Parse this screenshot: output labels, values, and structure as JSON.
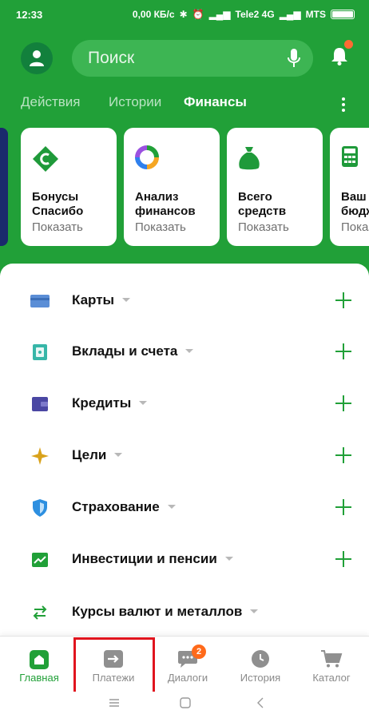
{
  "status_bar": {
    "time": "12:33",
    "speed": "0,00 КБ/с",
    "carrier1": "Tele2 4G",
    "carrier2": "MTS"
  },
  "header": {
    "search_placeholder": "Поиск"
  },
  "tabs": [
    {
      "label": "Действия",
      "active": false
    },
    {
      "label": "Истории",
      "active": false
    },
    {
      "label": "Финансы",
      "active": true
    }
  ],
  "cards": [
    {
      "line1": "Бонусы",
      "line2": "Спасибо",
      "action": "Показать",
      "icon": "spasibo-icon"
    },
    {
      "line1": "Анализ",
      "line2": "финансов",
      "action": "Показать",
      "icon": "pie-chart-icon"
    },
    {
      "line1": "Всего",
      "line2": "средств",
      "action": "Показать",
      "icon": "money-bag-icon"
    },
    {
      "line1": "Ваш",
      "line2": "бюджет",
      "action": "Показать",
      "icon": "calculator-icon"
    }
  ],
  "products": [
    {
      "label": "Карты",
      "icon": "card-icon",
      "has_add": true
    },
    {
      "label": "Вклады и счета",
      "icon": "safe-icon",
      "has_add": true
    },
    {
      "label": "Кредиты",
      "icon": "wallet-icon",
      "has_add": true
    },
    {
      "label": "Цели",
      "icon": "star-icon",
      "has_add": true
    },
    {
      "label": "Страхование",
      "icon": "shield-icon",
      "has_add": true
    },
    {
      "label": "Инвестиции и пенсии",
      "icon": "chart-icon",
      "has_add": true
    },
    {
      "label": "Курсы валют и металлов",
      "icon": "exchange-icon",
      "has_add": false
    }
  ],
  "bottom_nav": [
    {
      "label": "Главная",
      "active": true,
      "icon": "home-icon"
    },
    {
      "label": "Платежи",
      "active": false,
      "icon": "payments-icon"
    },
    {
      "label": "Диалоги",
      "active": false,
      "icon": "dialogs-icon",
      "badge": "2"
    },
    {
      "label": "История",
      "active": false,
      "icon": "history-icon"
    },
    {
      "label": "Каталог",
      "active": false,
      "icon": "cart-icon"
    }
  ],
  "colors": {
    "brand_green": "#21a038",
    "badge_orange": "#ff6a1a",
    "highlight_red": "#e0141e"
  }
}
